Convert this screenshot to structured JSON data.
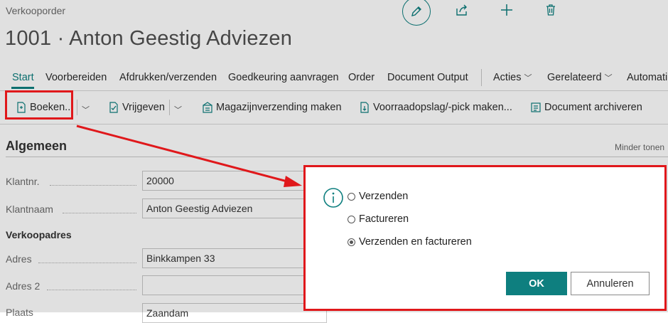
{
  "page": {
    "doc_type": "Verkooporder",
    "title": "1001 · Anton Geestig Adviezen"
  },
  "top_icons": [
    "pencil-icon",
    "share-icon",
    "plus-icon",
    "trash-icon"
  ],
  "action_bar": {
    "items": [
      "Start",
      "Voorbereiden",
      "Afdrukken/verzenden",
      "Goedkeuring aanvragen",
      "Order",
      "Document Output",
      "Acties",
      "Gerelateerd",
      "Automati"
    ]
  },
  "toolbar": {
    "post": "Boeken...",
    "release": "Vrijgeven",
    "warehouse_shipment": "Magazijnverzending maken",
    "inventory_pick": "Voorraadopslag/-pick maken...",
    "archive": "Document archiveren"
  },
  "general": {
    "section_title": "Algemeen",
    "show_less": "Minder tonen",
    "customer_no_label": "Klantnr.",
    "customer_no_value": "20000",
    "customer_name_label": "Klantnaam",
    "customer_name_value": "Anton Geestig Adviezen",
    "sell_to_address_heading": "Verkoopadres",
    "address_label": "Adres",
    "address_value": "Binkkampen 33",
    "address2_label": "Adres 2",
    "address2_value": "",
    "city_label": "Plaats",
    "city_value": "Zaandam"
  },
  "dialog": {
    "options": [
      "Verzenden",
      "Factureren",
      "Verzenden en factureren"
    ],
    "selected_index": 2,
    "ok_label": "OK",
    "cancel_label": "Annuleren"
  },
  "colors": {
    "accent": "#0e7f7f",
    "annotation": "#e0181b"
  }
}
